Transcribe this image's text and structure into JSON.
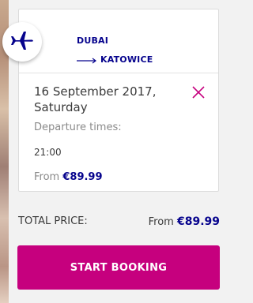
{
  "flight": {
    "from_city": "DUBAI",
    "to_city": "KATOWICE",
    "plane_icon": "airplane-icon",
    "arrow_icon": "long-arrow-right-icon",
    "close_icon": "close-icon",
    "date_line1": "16 September 2017,",
    "date_line2": "Saturday",
    "departure_label": "Departure times:",
    "departure_time": "21:00",
    "price_prefix": "From",
    "price": "€89.99"
  },
  "summary": {
    "total_label": "TOTAL PRICE:",
    "price_prefix": "From",
    "price": "€89.99"
  },
  "actions": {
    "start_booking_label": "START BOOKING"
  },
  "colors": {
    "brand_navy": "#06038d",
    "brand_magenta": "#c6007e"
  }
}
